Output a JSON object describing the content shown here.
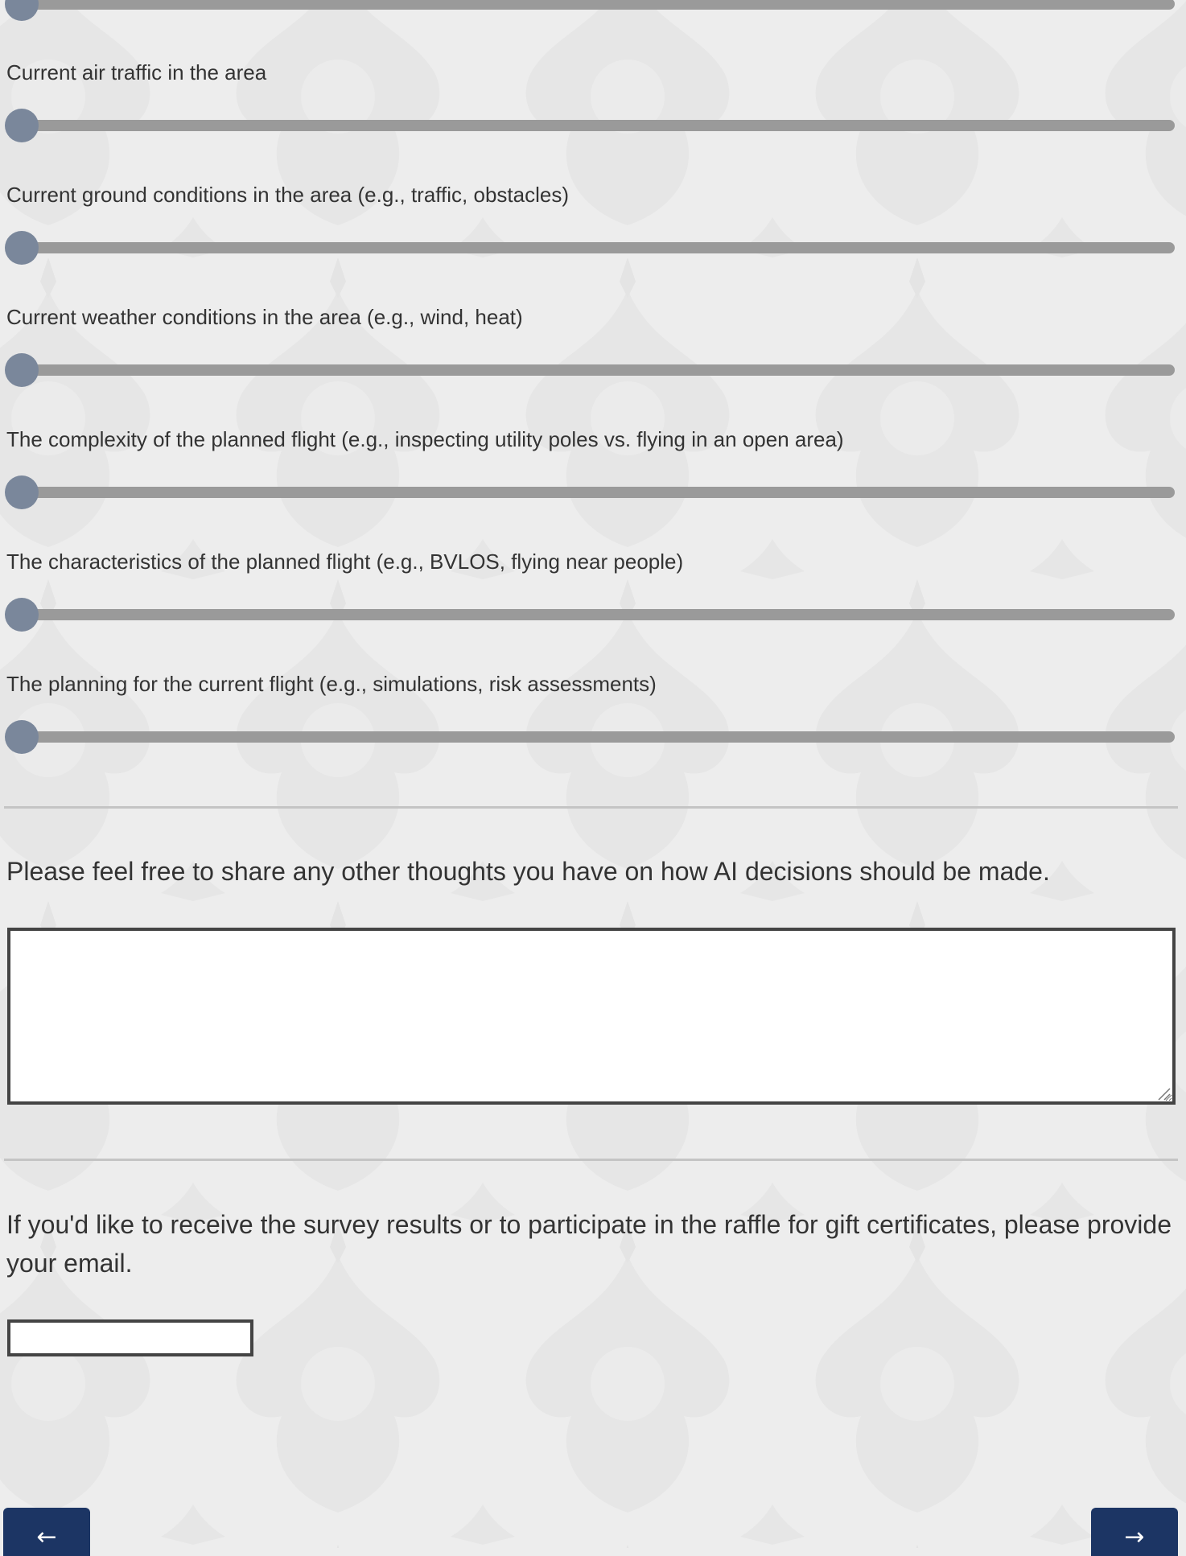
{
  "sliders": [
    {
      "id": "previous",
      "label": "",
      "value": 0
    },
    {
      "id": "air_traffic",
      "label": "Current air traffic in the area",
      "value": 0
    },
    {
      "id": "ground_conditions",
      "label": "Current ground conditions in the area (e.g., traffic, obstacles)",
      "value": 0
    },
    {
      "id": "weather_conditions",
      "label": "Current weather conditions in the area (e.g., wind, heat)",
      "value": 0
    },
    {
      "id": "flight_complexity",
      "label": "The complexity of the planned flight (e.g., inspecting utility poles vs. flying in an open area)",
      "value": 0
    },
    {
      "id": "flight_characteristics",
      "label": "The characteristics of the planned flight (e.g., BVLOS, flying near people)",
      "value": 0
    },
    {
      "id": "flight_planning",
      "label": "The planning for the current flight (e.g., simulations, risk assessments)",
      "value": 0
    }
  ],
  "thoughts_question": {
    "text": "Please feel free to share any other thoughts you have on how AI decisions should be made.",
    "value": ""
  },
  "email_question": {
    "text": "If you'd like to receive the survey results or to participate in the raffle for gift certificates, please provide your email.",
    "value": ""
  },
  "navigation": {
    "back_label": "←",
    "next_label": "→"
  },
  "colors": {
    "background": "#ededed",
    "slider_track": "#9a9a9a",
    "slider_thumb": "#7a879b",
    "nav_button": "#1c3564",
    "border": "#444444"
  }
}
